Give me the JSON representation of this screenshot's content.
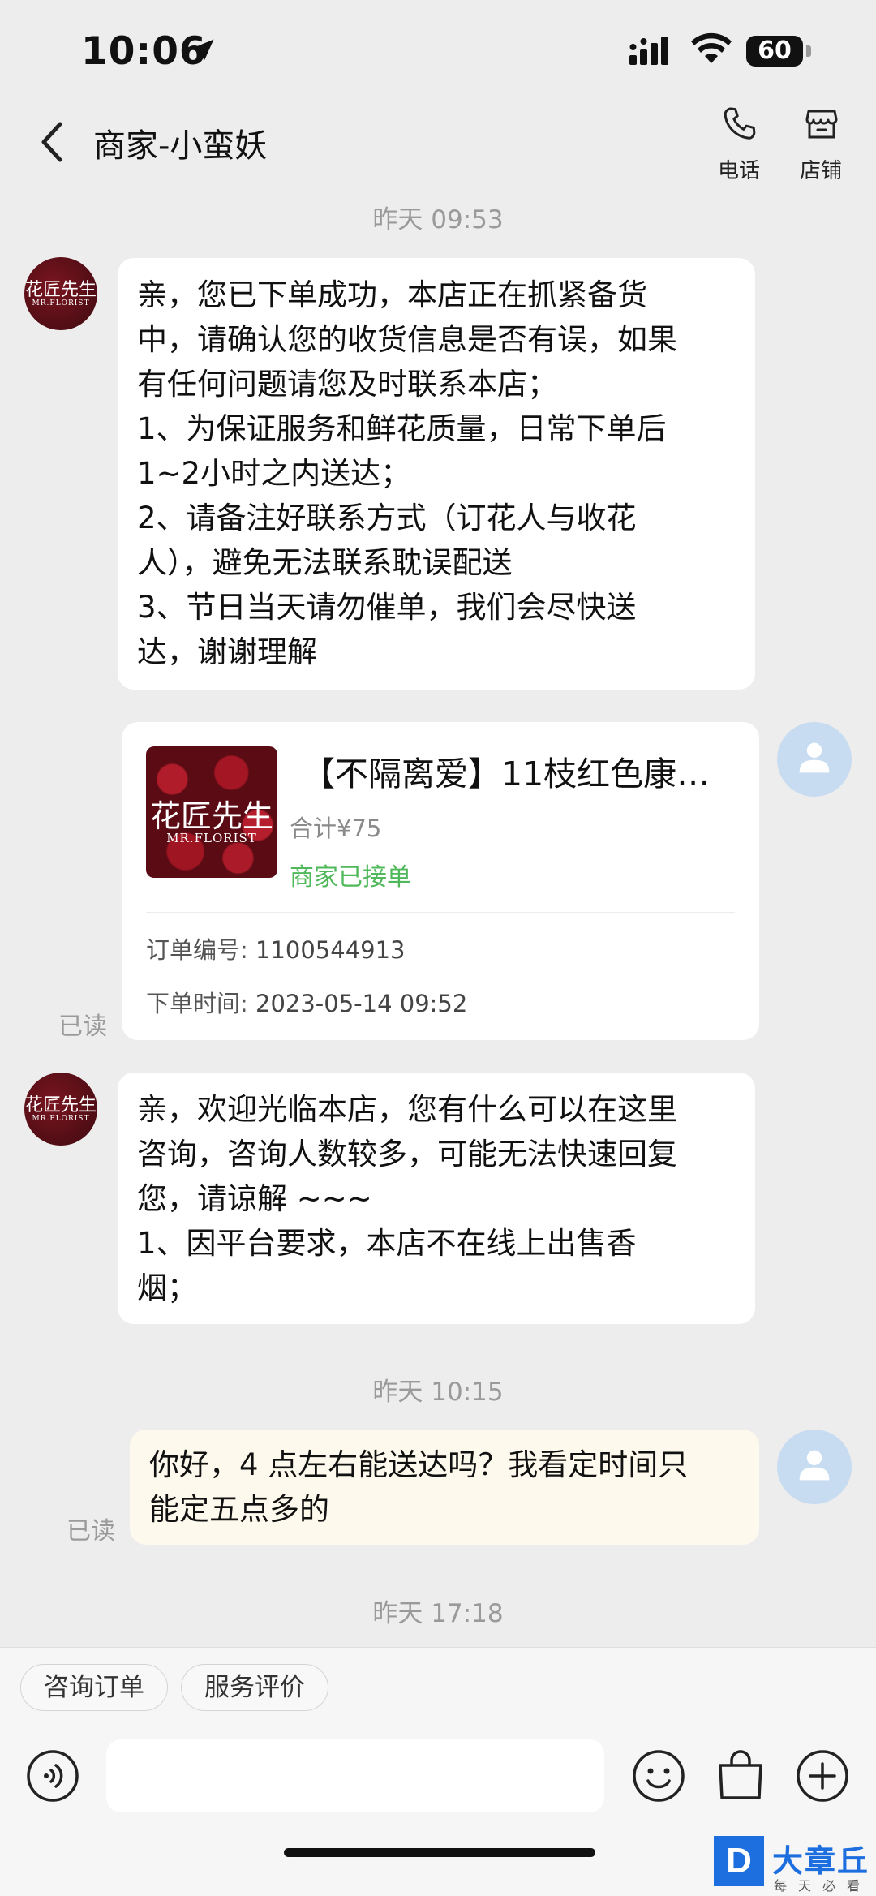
{
  "status_bar": {
    "time": "10:06",
    "battery": "60"
  },
  "header": {
    "title": "商家-小蛮妖",
    "phone_label": "电话",
    "shop_label": "店铺"
  },
  "shop_logo": {
    "name": "花匠先生",
    "sub": "MR.FLORIST"
  },
  "chat": {
    "ts1": "昨天 09:53",
    "msg1": "亲，您已下单成功，本店正在抓紧备货\n中，请确认您的收货信息是否有误，如果\n有任何问题请您及时联系本店；\n1、为保证服务和鲜花质量，日常下单后\n1~2小时之内送达；\n2、请备注好联系方式（订花人与收花\n人），避免无法联系耽误配送\n3、节日当天请勿催单，我们会尽快送\n达，谢谢理解",
    "order": {
      "title": "【不隔离爱】11枝红色康…",
      "total": "合计¥75",
      "status": "商家已接单",
      "order_no_label": "订单编号:",
      "order_no": "1100544913",
      "order_time_label": "下单时间:",
      "order_time": "2023-05-14 09:52"
    },
    "read1": "已读",
    "msg2": "亲，欢迎光临本店，您有什么可以在这里\n咨询，咨询人数较多，可能无法快速回复\n您，请谅解 ~~~\n1、因平台要求，本店不在线上出售香\n烟；",
    "ts2": "昨天 10:15",
    "msg3": "你好，4 点左右能送达吗？我看定时间只\n能定五点多的",
    "read2": "已读",
    "ts3": "昨天 17:18"
  },
  "quick_actions": [
    "咨询订单",
    "服务评价"
  ],
  "input": {
    "placeholder": ""
  },
  "watermark": {
    "name": "大章丘",
    "sub": "每天必看"
  }
}
